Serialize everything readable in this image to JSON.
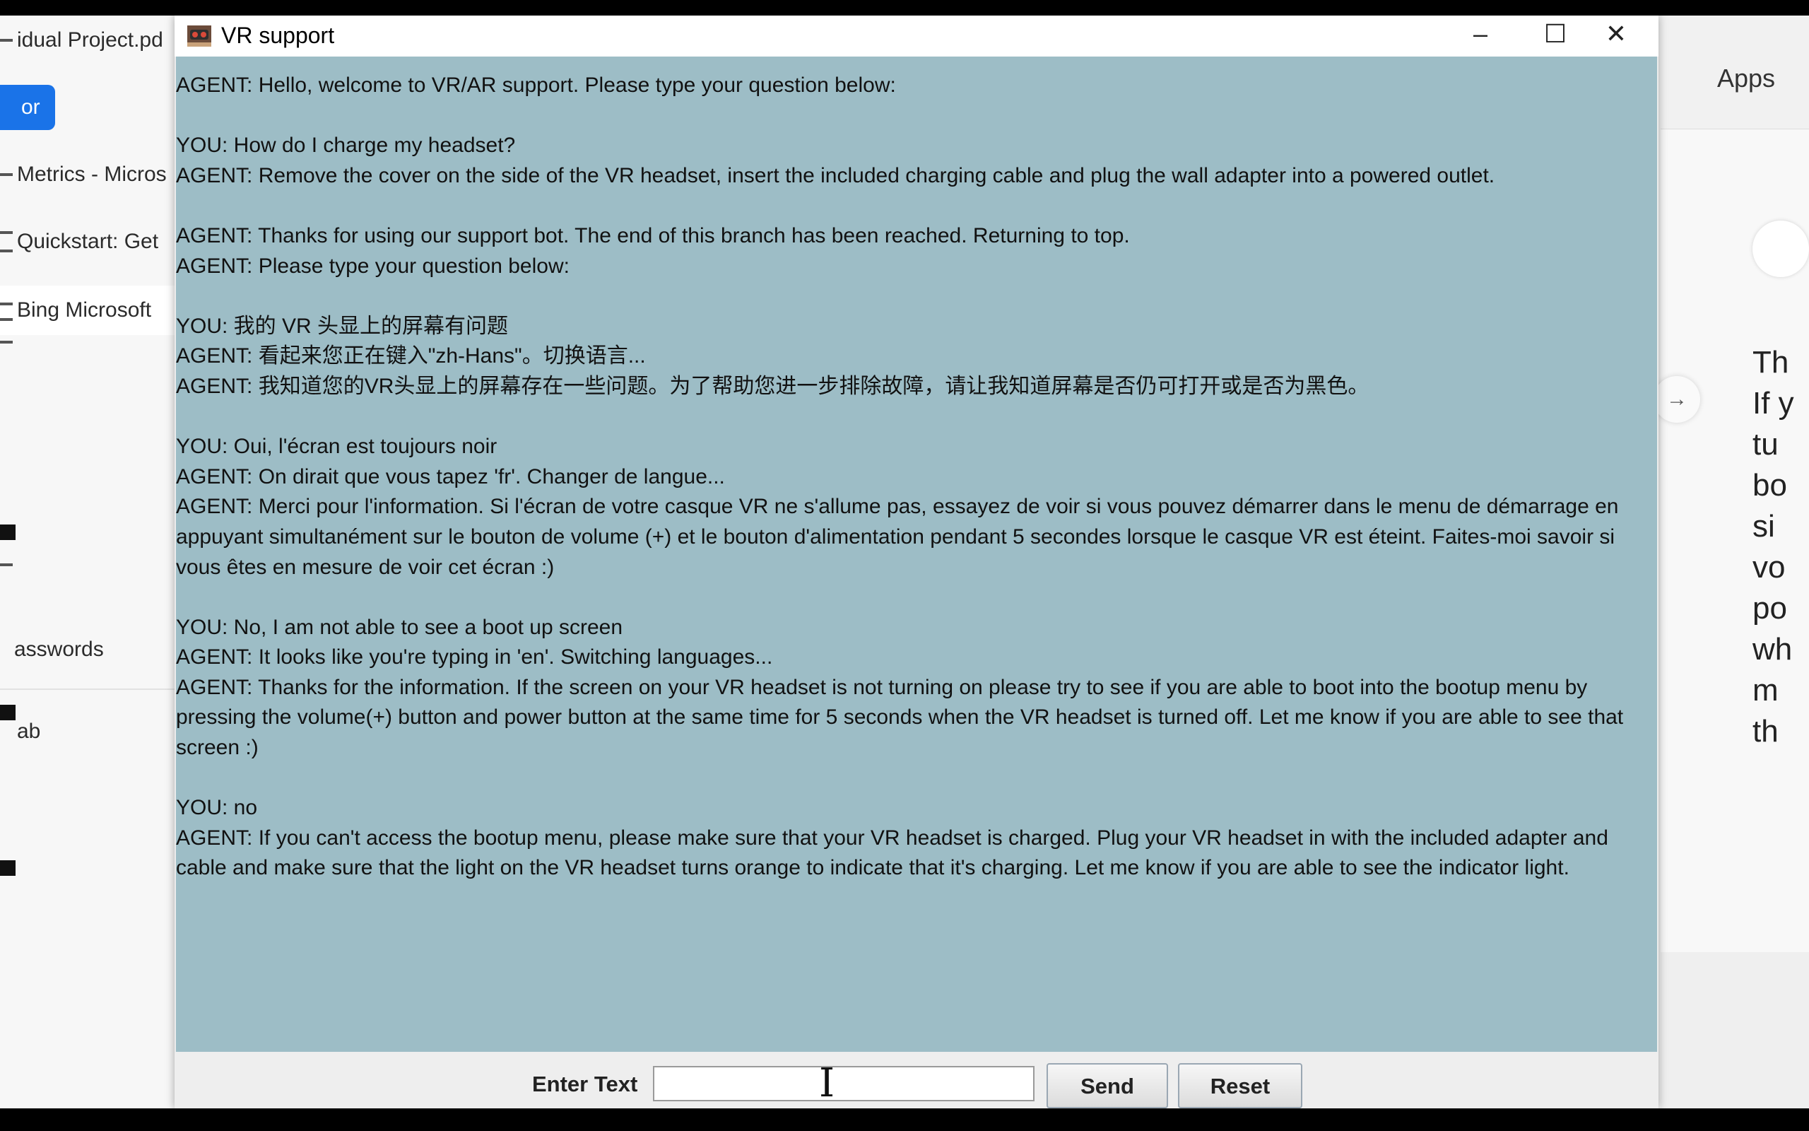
{
  "left_panel": {
    "button_label": "or",
    "items": [
      {
        "label": "idual Project.pd"
      },
      {
        "label": "Metrics - Micros"
      },
      {
        "label": "Quickstart: Get"
      },
      {
        "label": "Bing Microsoft"
      },
      {
        "label": "asswords"
      },
      {
        "label": "ab"
      }
    ]
  },
  "right_panel": {
    "apps_label": "Apps",
    "lines": [
      "Th",
      "If y",
      "tu",
      "bo",
      "si",
      "vo",
      "po",
      "wh",
      "m",
      "th"
    ]
  },
  "window": {
    "title": "VR support",
    "icon": "vr-headset-icon",
    "controls": {
      "minimize": "–",
      "maximize": "☐",
      "close": "✕"
    }
  },
  "chat": {
    "messages": [
      "AGENT: Hello, welcome to VR/AR support. Please type your question below:",
      "",
      "YOU: How do I charge my headset?",
      "AGENT: Remove the cover on the side of the VR headset, insert the included charging cable and plug the wall adapter into a powered outlet.",
      "",
      "AGENT: Thanks for using our support bot. The end of this branch has been reached. Returning to top.",
      "AGENT: Please type your question below:",
      "",
      "YOU: 我的 VR 头显上的屏幕有问题",
      "AGENT: 看起来您正在键入\"zh-Hans\"。切换语言...",
      "AGENT: 我知道您的VR头显上的屏幕存在一些问题。为了帮助您进一步排除故障，请让我知道屏幕是否仍可打开或是否为黑色。",
      "",
      "YOU: Oui, l'écran est toujours noir",
      "AGENT: On dirait que vous tapez 'fr'. Changer de langue...",
      "AGENT: Merci pour l'information. Si l'écran de votre casque VR ne s'allume pas, essayez de voir si vous pouvez démarrer dans le menu de démarrage en appuyant simultanément sur le bouton de volume (+) et le bouton d'alimentation pendant 5 secondes lorsque le casque VR est éteint. Faites-moi savoir si vous êtes en mesure de voir cet écran :)",
      "",
      "YOU: No, I am not able to see a boot up screen",
      "AGENT: It looks like you're typing in 'en'. Switching languages...",
      "AGENT: Thanks for the information. If the screen on your VR headset is not turning on please try to see if you are able to boot into the bootup menu by pressing the volume(+) button and power button at the same time for 5 seconds when the VR headset is turned off. Let me know if you are able to see that screen :)",
      "",
      "YOU: no",
      "AGENT: If you can't access the bootup menu, please make sure that your VR headset is charged. Plug your VR headset in with the included adapter and cable and make sure that the light on the VR headset turns orange to indicate that it's charging. Let me know if you are able to see the indicator light."
    ]
  },
  "input": {
    "label": "Enter Text",
    "value": "",
    "send_label": "Send",
    "reset_label": "Reset"
  },
  "colors": {
    "chat_background": "#9dbdc6",
    "accent": "#1a73e8"
  }
}
